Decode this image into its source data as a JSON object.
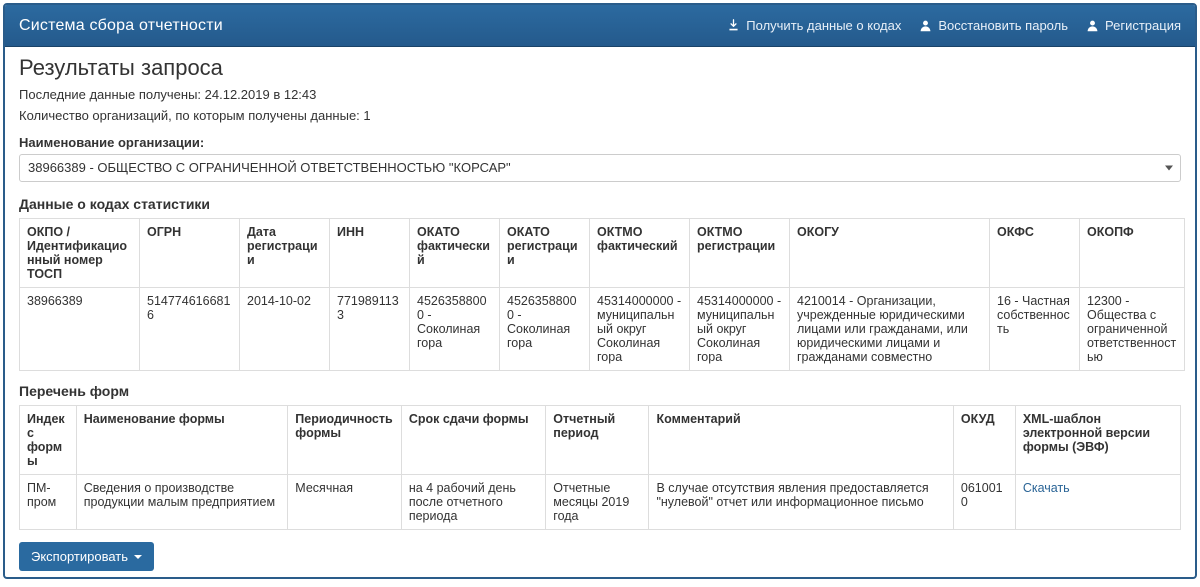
{
  "navbar": {
    "brand": "Система сбора отчетности",
    "links": {
      "get_codes": "Получить данные о кодах",
      "restore_pw": "Восстановить пароль",
      "register": "Регистрация"
    }
  },
  "page_title": "Результаты запроса",
  "meta": {
    "last_received": "Последние данные получены: 24.12.2019 в 12:43",
    "org_count": "Количество организаций, по которым получены данные: 1"
  },
  "org_select": {
    "label": "Наименование организации:",
    "value": "38966389 - ОБЩЕСТВО С ОГРАНИЧЕННОЙ ОТВЕТСТВЕННОСТЬЮ \"КОРСАР\""
  },
  "stats_section": {
    "heading": "Данные о кодах статистики",
    "headers": {
      "okpo": "ОКПО / Идентификационный номер ТОСП",
      "ogrn": "ОГРН",
      "reg_date": "Дата регистрации",
      "inn": "ИНН",
      "okato_fact": "ОКАТО фактический",
      "okato_reg": "ОКАТО регистрации",
      "oktmo_fact": "ОКТМО фактический",
      "oktmo_reg": "ОКТМО регистрации",
      "okogu": "ОКОГУ",
      "okfs": "ОКФС",
      "okopf": "ОКОПФ"
    },
    "row": {
      "okpo": "38966389",
      "ogrn": "5147746166816",
      "reg_date": "2014-10-02",
      "inn": "7719891133",
      "okato_fact": "45263588000 - Соколиная гора",
      "okato_reg": "45263588000 - Соколиная гора",
      "oktmo_fact": "45314000000 - муниципальный округ Соколиная гора",
      "oktmo_reg": "45314000000 - муниципальный округ Соколиная гора",
      "okogu": "4210014 - Организации, учрежденные юридическими лицами или гражданами, или юридическими лицами и гражданами совместно",
      "okfs": "16 - Частная собственность",
      "okopf": "12300 - Общества с ограниченной ответственностью"
    }
  },
  "forms_section": {
    "heading": "Перечень форм",
    "headers": {
      "idx": "Индекс формы",
      "name": "Наименование формы",
      "periodicity": "Периодичность формы",
      "deadline": "Срок сдачи формы",
      "report_period": "Отчетный период",
      "comment": "Комментарий",
      "okud": "ОКУД",
      "xml": "XML-шаблон электронной версии формы (ЭВФ)"
    },
    "row": {
      "idx": "ПМ-пром",
      "name": "Сведения о производстве продукции малым предприятием",
      "periodicity": "Месячная",
      "deadline": "на 4 рабочий день после отчетного периода",
      "report_period": "Отчетные месяцы 2019 года",
      "comment": "В случае отсутствия явления предоставляется \"нулевой\" отчет или информационное письмо",
      "okud": "0610010",
      "xml": "Скачать"
    }
  },
  "export_btn": "Экспортировать"
}
